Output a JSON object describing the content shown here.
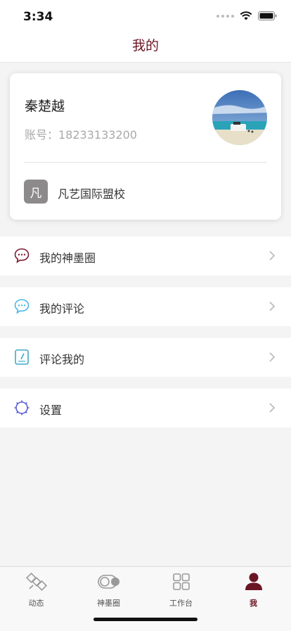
{
  "status": {
    "time": "3:34"
  },
  "header": {
    "title": "我的"
  },
  "profile": {
    "name": "秦楚越",
    "account": "账号：18233133200",
    "school_badge": "凡",
    "school_name": "凡艺国际盟校"
  },
  "menu": [
    {
      "label": "我的神墨圈",
      "icon": "chat-bubble-icon"
    },
    {
      "label": "我的评论",
      "icon": "comment-icon"
    },
    {
      "label": "评论我的",
      "icon": "note-icon"
    },
    {
      "label": "设置",
      "icon": "gear-icon"
    }
  ],
  "tabs": [
    {
      "label": "动态",
      "icon": "satellite-icon"
    },
    {
      "label": "神墨圈",
      "icon": "toggle-icon"
    },
    {
      "label": "工作台",
      "icon": "grid-icon"
    },
    {
      "label": "我",
      "icon": "person-icon",
      "active": true
    }
  ],
  "colors": {
    "accent": "#6a1524",
    "background": "#f4f4f4"
  }
}
